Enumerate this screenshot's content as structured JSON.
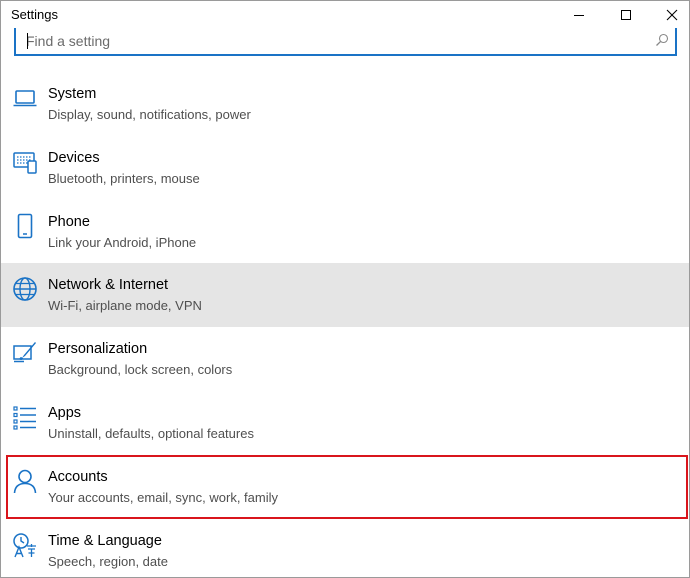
{
  "window": {
    "title": "Settings"
  },
  "search": {
    "placeholder": "Find a setting"
  },
  "items": [
    {
      "label": "System",
      "sub": "Display, sound, notifications, power",
      "icon": "laptop-icon"
    },
    {
      "label": "Devices",
      "sub": "Bluetooth, printers, mouse",
      "icon": "devices-icon"
    },
    {
      "label": "Phone",
      "sub": "Link your Android, iPhone",
      "icon": "phone-icon"
    },
    {
      "label": "Network & Internet",
      "sub": "Wi-Fi, airplane mode, VPN",
      "icon": "globe-icon"
    },
    {
      "label": "Personalization",
      "sub": "Background, lock screen, colors",
      "icon": "paintbrush-icon"
    },
    {
      "label": "Apps",
      "sub": "Uninstall, defaults, optional features",
      "icon": "apps-list-icon"
    },
    {
      "label": "Accounts",
      "sub": "Your accounts, email, sync, work, family",
      "icon": "person-icon"
    },
    {
      "label": "Time & Language",
      "sub": "Speech, region, date",
      "icon": "time-language-icon"
    }
  ],
  "colors": {
    "accent": "#1a73c6",
    "highlight_border": "#d9151c",
    "selected_bg": "#e5e5e5"
  }
}
